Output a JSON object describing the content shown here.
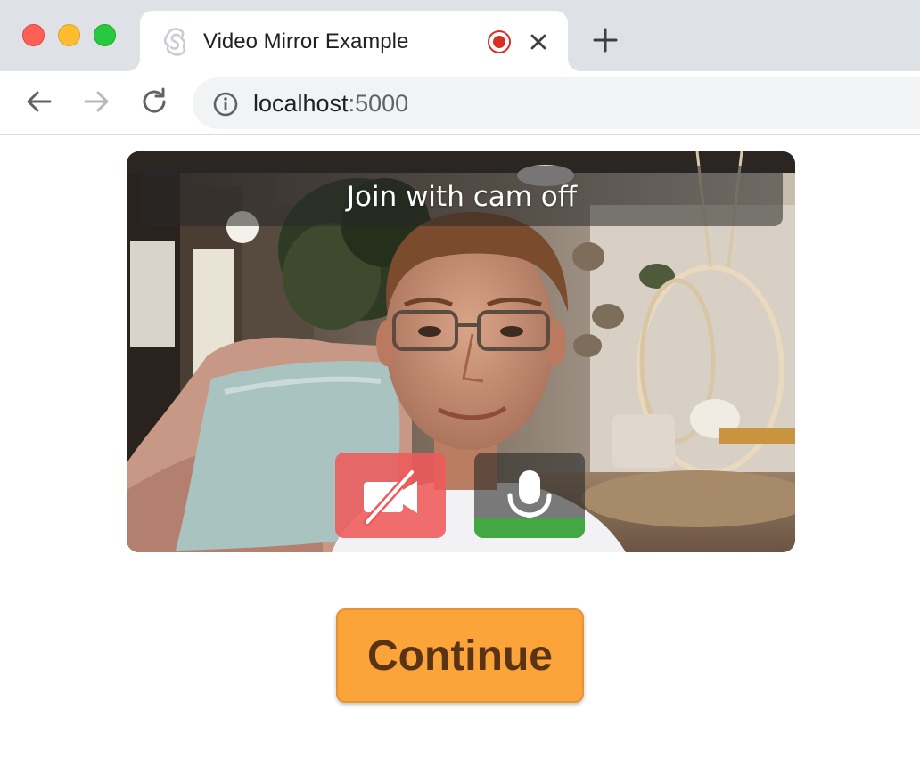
{
  "browser": {
    "tab": {
      "title": "Video Mirror Example",
      "favicon": "svelte-logo-icon",
      "recording_icon": "record-icon",
      "close_icon": "close-icon"
    },
    "new_tab_icon": "plus-icon",
    "nav": {
      "back_icon": "back-arrow-icon",
      "forward_icon": "forward-arrow-icon",
      "reload_icon": "reload-icon"
    },
    "address": {
      "info_icon": "info-icon",
      "host": "localhost",
      "port": ":5000"
    }
  },
  "video": {
    "banner": "Join with cam off",
    "controls": {
      "camera": {
        "icon": "camera-off-icon",
        "state": "off",
        "color": "#ee5a5a"
      },
      "microphone": {
        "icon": "microphone-icon",
        "state": "on",
        "level_color": "#43a843"
      }
    }
  },
  "continue_button": {
    "label": "Continue",
    "color": "#fba43a"
  }
}
